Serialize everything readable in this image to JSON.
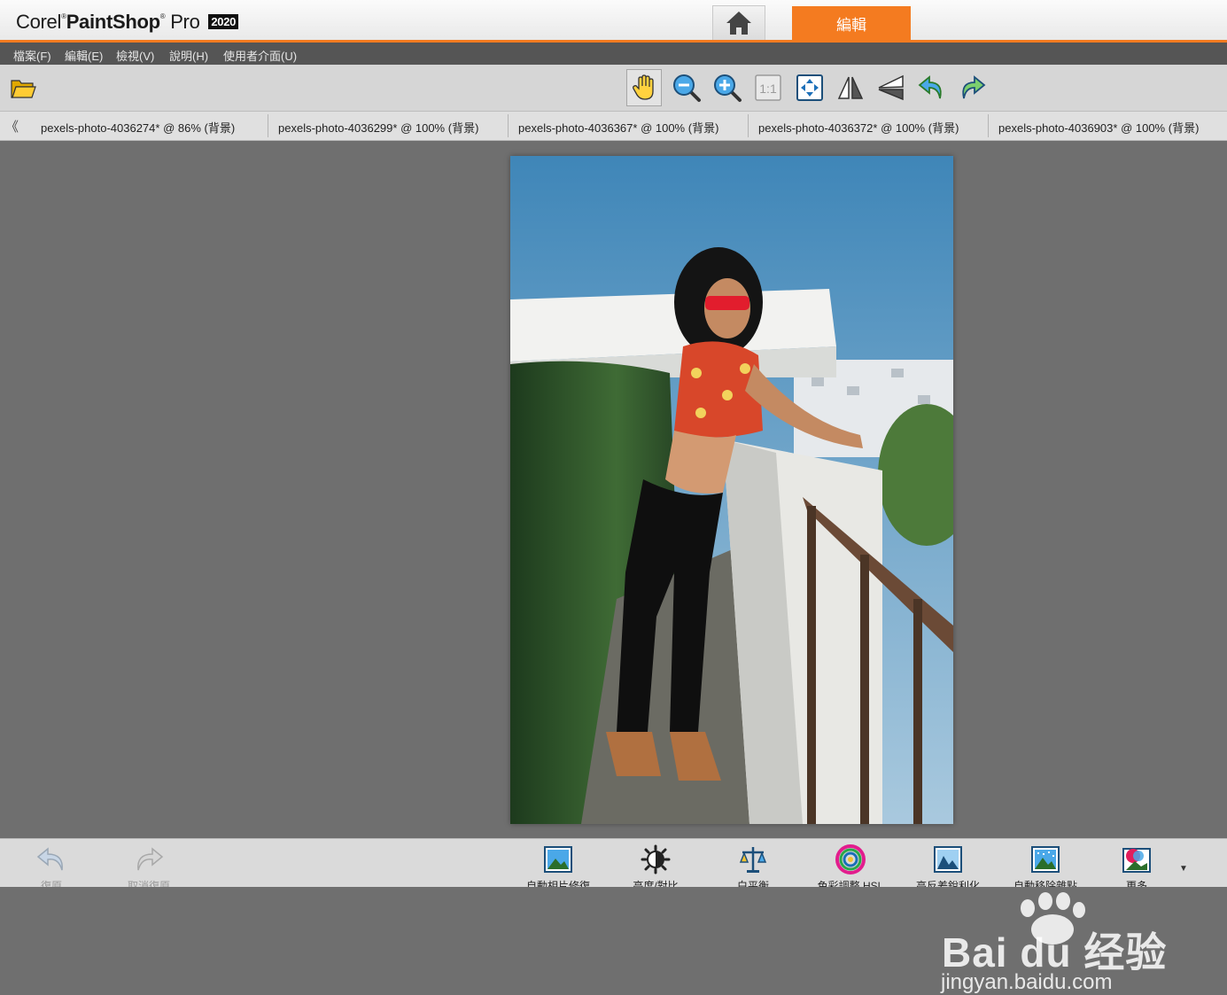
{
  "app": {
    "logo_brand": "Corel",
    "logo_product": "PaintShop",
    "logo_pro": "Pro",
    "logo_year": "2020"
  },
  "tabs": {
    "home_icon": "home-icon",
    "edit_label": "編輯",
    "accent_color": "#f47b20"
  },
  "menu": {
    "items": [
      "檔案(F)",
      "編輯(E)",
      "檢視(V)",
      "說明(H)",
      "使用者介面(U)"
    ]
  },
  "toolbar": {
    "icons": [
      "open-folder-icon",
      "pan-hand-icon",
      "zoom-out-icon",
      "zoom-in-icon",
      "actual-size-icon",
      "fit-to-window-icon",
      "flip-horizontal-icon",
      "flip-vertical-icon",
      "rotate-left-icon",
      "rotate-right-icon"
    ],
    "actual_size_label": "1:1"
  },
  "document_tabs": [
    {
      "name": "pexels-photo-4036274*",
      "zoom": "@  86%",
      "layer": "(背景)"
    },
    {
      "name": "pexels-photo-4036299*",
      "zoom": "@ 100%",
      "layer": "(背景)"
    },
    {
      "name": "pexels-photo-4036367*",
      "zoom": "@ 100%",
      "layer": "(背景)"
    },
    {
      "name": "pexels-photo-4036372*",
      "zoom": "@ 100%",
      "layer": "(背景)"
    },
    {
      "name": "pexels-photo-4036903*",
      "zoom": "@ 100%",
      "layer": "(背景)"
    }
  ],
  "bottom_actions": [
    {
      "label": "復原",
      "icon": "undo-icon",
      "enabled": false
    },
    {
      "label": "取消復原",
      "icon": "redo-icon",
      "enabled": false
    },
    {
      "label": "自動相片修復",
      "icon": "photo-fix-icon",
      "enabled": true
    },
    {
      "label": "亮度/對比",
      "icon": "brightness-icon",
      "enabled": true
    },
    {
      "label": "白平衡",
      "icon": "white-balance-icon",
      "enabled": true
    },
    {
      "label": "色彩調整 HSL",
      "icon": "hsl-icon",
      "enabled": true
    },
    {
      "label": "高反差銳利化",
      "icon": "sharpen-icon",
      "enabled": true
    },
    {
      "label": "自動移除雜點",
      "icon": "noise-removal-icon",
      "enabled": true
    },
    {
      "label": "更多",
      "icon": "more-icon",
      "enabled": true
    }
  ],
  "watermark": {
    "text": "Bai du 经验",
    "url": "jingyan.baidu.com"
  }
}
